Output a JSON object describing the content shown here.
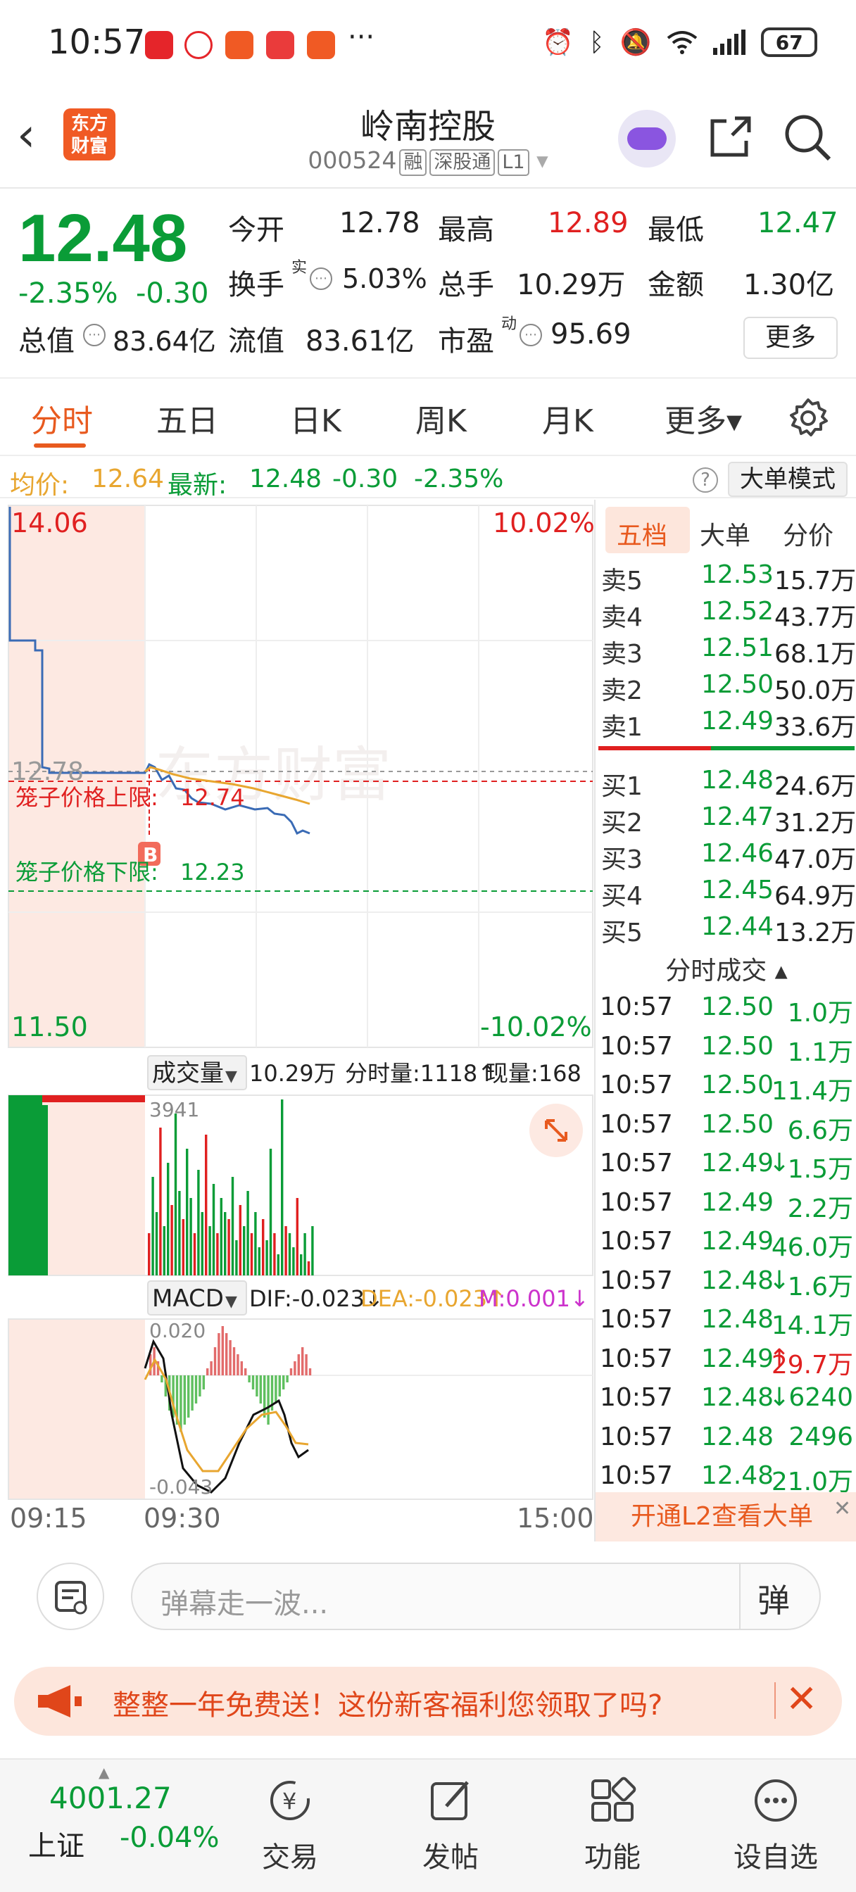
{
  "status_bar": {
    "time": "10:57",
    "more": "···",
    "battery": "67"
  },
  "header": {
    "logo_top": "东方",
    "logo_bottom": "财富",
    "stock_name": "岭南控股",
    "stock_code": "000524",
    "tags": [
      "融",
      "深股通",
      "L1"
    ]
  },
  "quote": {
    "price": "12.48",
    "change_pct": "-2.35%",
    "change": "-0.30",
    "fields": {
      "open_label": "今开",
      "open": "12.78",
      "high_label": "最高",
      "high": "12.89",
      "low_label": "最低",
      "low": "12.47",
      "turnover_label": "换手",
      "turnover_sup": "实",
      "turnover": "5.03%",
      "volume_label": "总手",
      "volume": "10.29万",
      "amount_label": "金额",
      "amount": "1.30亿",
      "mcap_label": "总值",
      "mcap": "83.64亿",
      "float_label": "流值",
      "float": "83.61亿",
      "pe_label": "市盈",
      "pe_sup": "动",
      "pe": "95.69"
    },
    "more_label": "更多"
  },
  "tabs": [
    "分时",
    "五日",
    "日K",
    "周K",
    "月K",
    "更多▾"
  ],
  "avg_line": {
    "avg_label": "均价:",
    "avg": "12.64",
    "latest_label": "最新:",
    "latest": "12.48",
    "change": "-0.30",
    "pct": "-2.35%",
    "big_order_mode": "大单模式"
  },
  "chart": {
    "y_top": "14.06",
    "y_top_pct": "10.02%",
    "y_bottom": "11.50",
    "y_bottom_pct": "-10.02%",
    "ref_price": "12.78",
    "cage_upper_label": "笼子价格上限:",
    "cage_upper": "12.74",
    "cage_lower_label": "笼子价格下限:",
    "cage_lower": "12.23",
    "b_marker": "B",
    "watermark": "东方财富",
    "volume_select": "成交量",
    "volume_total": "10.29万",
    "minute_vol": "分时量:1118↑",
    "current_vol": "现量:168",
    "vol_max": "3941",
    "macd_select": "MACD",
    "dif": "DIF:-0.023↓",
    "dea": "DEA:-0.023↑",
    "m": "M:0.001↓",
    "macd_top": "0.020",
    "macd_bottom": "-0.043",
    "time_start": "09:15",
    "time_open": "09:30",
    "time_end": "15:00"
  },
  "order_book": {
    "tabs": [
      "五档",
      "大单",
      "分价"
    ],
    "asks": [
      {
        "label": "卖5",
        "price": "12.53",
        "vol": "15.7万"
      },
      {
        "label": "卖4",
        "price": "12.52",
        "vol": "43.7万"
      },
      {
        "label": "卖3",
        "price": "12.51",
        "vol": "68.1万"
      },
      {
        "label": "卖2",
        "price": "12.50",
        "vol": "50.0万"
      },
      {
        "label": "卖1",
        "price": "12.49",
        "vol": "33.6万"
      }
    ],
    "bids": [
      {
        "label": "买1",
        "price": "12.48",
        "vol": "24.6万"
      },
      {
        "label": "买2",
        "price": "12.47",
        "vol": "31.2万"
      },
      {
        "label": "买3",
        "price": "12.46",
        "vol": "47.0万"
      },
      {
        "label": "买4",
        "price": "12.45",
        "vol": "64.9万"
      },
      {
        "label": "买5",
        "price": "12.44",
        "vol": "13.2万"
      }
    ],
    "ticks_title": "分时成交 ▴",
    "ticks": [
      {
        "time": "10:57",
        "price": "12.50",
        "vol": "1.0万",
        "dir": "",
        "color": "#0a9c37"
      },
      {
        "time": "10:57",
        "price": "12.50",
        "vol": "1.1万",
        "dir": "",
        "color": "#0a9c37"
      },
      {
        "time": "10:57",
        "price": "12.50",
        "vol": "11.4万",
        "dir": "",
        "color": "#0a9c37"
      },
      {
        "time": "10:57",
        "price": "12.50",
        "vol": "6.6万",
        "dir": "",
        "color": "#0a9c37"
      },
      {
        "time": "10:57",
        "price": "12.49",
        "vol": "1.5万",
        "dir": "↓",
        "color": "#0a9c37"
      },
      {
        "time": "10:57",
        "price": "12.49",
        "vol": "2.2万",
        "dir": "",
        "color": "#0a9c37"
      },
      {
        "time": "10:57",
        "price": "12.49",
        "vol": "46.0万",
        "dir": "",
        "color": "#0a9c37"
      },
      {
        "time": "10:57",
        "price": "12.48",
        "vol": "1.6万",
        "dir": "↓",
        "color": "#0a9c37"
      },
      {
        "time": "10:57",
        "price": "12.48",
        "vol": "14.1万",
        "dir": "",
        "color": "#0a9c37"
      },
      {
        "time": "10:57",
        "price": "12.49",
        "vol": "29.7万",
        "dir": "↑",
        "color": "#e02020"
      },
      {
        "time": "10:57",
        "price": "12.48",
        "vol": "6240",
        "dir": "↓",
        "color": "#0a9c37"
      },
      {
        "time": "10:57",
        "price": "12.48",
        "vol": "2496",
        "dir": "",
        "color": "#0a9c37"
      },
      {
        "time": "10:57",
        "price": "12.48",
        "vol": "21.0万",
        "dir": "",
        "color": "#0a9c37"
      }
    ],
    "l2_banner": "开通L2查看大单"
  },
  "comment": {
    "placeholder": "弹幕走一波...",
    "danmu_label": "弹"
  },
  "promo": {
    "text": "整整一年免费送！这份新客福利您领取了吗?"
  },
  "bottom_nav": {
    "index_value": "4001.27",
    "index_name": "上证",
    "index_change": "-0.04%",
    "items": [
      "交易",
      "发帖",
      "功能",
      "设自选"
    ]
  },
  "colors": {
    "up": "#e02020",
    "down": "#0a9c37",
    "accent": "#e85a1f",
    "price_line": "#3a6bb5",
    "avg_line": "#e8a630"
  }
}
